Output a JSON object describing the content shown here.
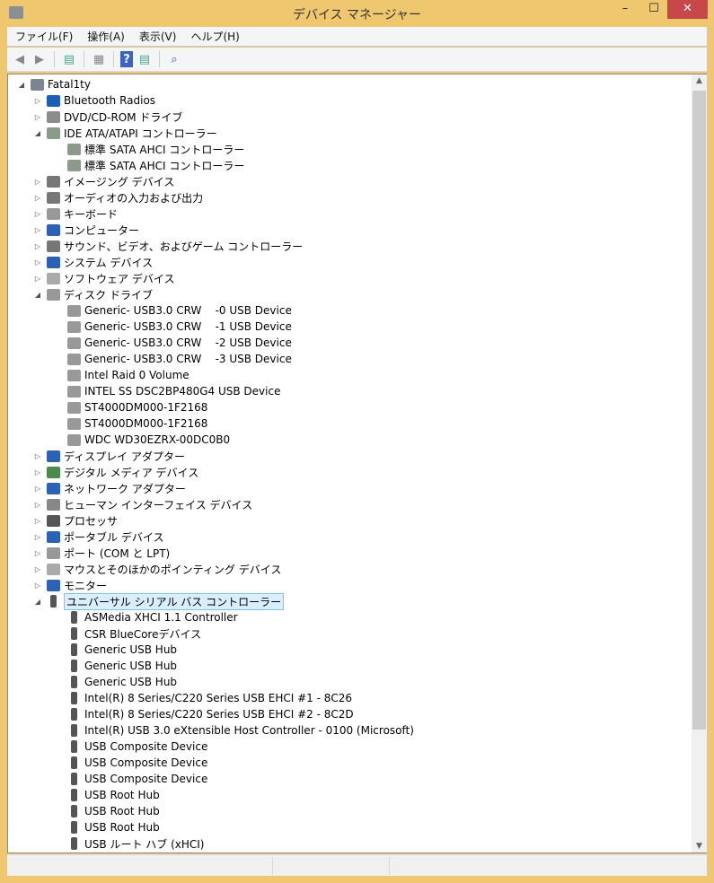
{
  "window": {
    "title": "デバイス マネージャー",
    "minimize": "–",
    "maximize": "☐",
    "close": "✕"
  },
  "menu": [
    "ファイル(F)",
    "操作(A)",
    "表示(V)",
    "ヘルプ(H)"
  ],
  "tree": [
    {
      "label": "Fatal1ty",
      "level": 0,
      "exp": "open",
      "icon": "computer-icon",
      "color": "#7c8591"
    },
    {
      "label": "Bluetooth Radios",
      "level": 1,
      "exp": "closed",
      "icon": "bluetooth-icon",
      "color": "#1d5fb8"
    },
    {
      "label": "DVD/CD-ROM ドライブ",
      "level": 1,
      "exp": "closed",
      "icon": "dvd-drive-icon",
      "color": "#8c8c8c"
    },
    {
      "label": "IDE ATA/ATAPI コントローラー",
      "level": 1,
      "exp": "open",
      "icon": "ide-controller-icon",
      "color": "#8c9a8c"
    },
    {
      "label": "標準 SATA AHCI コントローラー",
      "level": 2,
      "icon": "ide-controller-icon",
      "color": "#8c9a8c"
    },
    {
      "label": "標準 SATA AHCI コントローラー",
      "level": 2,
      "icon": "ide-controller-icon",
      "color": "#8c9a8c"
    },
    {
      "label": "イメージング デバイス",
      "level": 1,
      "exp": "closed",
      "icon": "scanner-icon",
      "color": "#777"
    },
    {
      "label": "オーディオの入力および出力",
      "level": 1,
      "exp": "closed",
      "icon": "speaker-icon",
      "color": "#777"
    },
    {
      "label": "キーボード",
      "level": 1,
      "exp": "closed",
      "icon": "keyboard-icon",
      "color": "#999"
    },
    {
      "label": "コンピューター",
      "level": 1,
      "exp": "closed",
      "icon": "monitor-icon",
      "color": "#2a62b8"
    },
    {
      "label": "サウンド、ビデオ、およびゲーム コントローラー",
      "level": 1,
      "exp": "closed",
      "icon": "speaker-icon",
      "color": "#777"
    },
    {
      "label": "システム デバイス",
      "level": 1,
      "exp": "closed",
      "icon": "monitor-icon",
      "color": "#2a62b8"
    },
    {
      "label": "ソフトウェア デバイス",
      "level": 1,
      "exp": "closed",
      "icon": "software-device-icon",
      "color": "#aaa"
    },
    {
      "label": "ディスク ドライブ",
      "level": 1,
      "exp": "open",
      "icon": "disk-drive-icon",
      "color": "#999"
    },
    {
      "label": "Generic- USB3.0 CRW    -0 USB Device",
      "level": 2,
      "icon": "disk-drive-icon",
      "color": "#999"
    },
    {
      "label": "Generic- USB3.0 CRW    -1 USB Device",
      "level": 2,
      "icon": "disk-drive-icon",
      "color": "#999"
    },
    {
      "label": "Generic- USB3.0 CRW    -2 USB Device",
      "level": 2,
      "icon": "disk-drive-icon",
      "color": "#999"
    },
    {
      "label": "Generic- USB3.0 CRW    -3 USB Device",
      "level": 2,
      "icon": "disk-drive-icon",
      "color": "#999"
    },
    {
      "label": "Intel Raid 0 Volume",
      "level": 2,
      "icon": "disk-drive-icon",
      "color": "#999"
    },
    {
      "label": "INTEL SS DSC2BP480G4 USB Device",
      "level": 2,
      "icon": "disk-drive-icon",
      "color": "#999"
    },
    {
      "label": "ST4000DM000-1F2168",
      "level": 2,
      "icon": "disk-drive-icon",
      "color": "#999"
    },
    {
      "label": "ST4000DM000-1F2168",
      "level": 2,
      "icon": "disk-drive-icon",
      "color": "#999"
    },
    {
      "label": "WDC WD30EZRX-00DC0B0",
      "level": 2,
      "icon": "disk-drive-icon",
      "color": "#999"
    },
    {
      "label": "ディスプレイ アダプター",
      "level": 1,
      "exp": "closed",
      "icon": "display-adapter-icon",
      "color": "#2a62b8"
    },
    {
      "label": "デジタル メディア デバイス",
      "level": 1,
      "exp": "closed",
      "icon": "media-device-icon",
      "color": "#4a8a4a"
    },
    {
      "label": "ネットワーク アダプター",
      "level": 1,
      "exp": "closed",
      "icon": "network-icon",
      "color": "#2a62b8"
    },
    {
      "label": "ヒューマン インターフェイス デバイス",
      "level": 1,
      "exp": "closed",
      "icon": "hid-icon",
      "color": "#888"
    },
    {
      "label": "プロセッサ",
      "level": 1,
      "exp": "closed",
      "icon": "processor-icon",
      "color": "#555"
    },
    {
      "label": "ポータブル デバイス",
      "level": 1,
      "exp": "closed",
      "icon": "portable-device-icon",
      "color": "#2a62b8"
    },
    {
      "label": "ポート (COM と LPT)",
      "level": 1,
      "exp": "closed",
      "icon": "port-icon",
      "color": "#999"
    },
    {
      "label": "マウスとそのほかのポインティング デバイス",
      "level": 1,
      "exp": "closed",
      "icon": "mouse-icon",
      "color": "#aaa"
    },
    {
      "label": "モニター",
      "level": 1,
      "exp": "closed",
      "icon": "monitor-icon",
      "color": "#2a62b8"
    },
    {
      "label": "ユニバーサル シリアル バス コントローラー",
      "level": 1,
      "exp": "open",
      "icon": "usb-icon",
      "color": "#555",
      "selected": true
    },
    {
      "label": "ASMedia XHCI 1.1 Controller",
      "level": 2,
      "icon": "usb-icon",
      "color": "#555"
    },
    {
      "label": "CSR BlueCoreデバイス",
      "level": 2,
      "icon": "usb-icon",
      "color": "#555"
    },
    {
      "label": "Generic USB Hub",
      "level": 2,
      "icon": "usb-icon",
      "color": "#555"
    },
    {
      "label": "Generic USB Hub",
      "level": 2,
      "icon": "usb-icon",
      "color": "#555"
    },
    {
      "label": "Generic USB Hub",
      "level": 2,
      "icon": "usb-icon",
      "color": "#555"
    },
    {
      "label": "Intel(R) 8 Series/C220 Series USB EHCI #1 - 8C26",
      "level": 2,
      "icon": "usb-icon",
      "color": "#555"
    },
    {
      "label": "Intel(R) 8 Series/C220 Series USB EHCI #2 - 8C2D",
      "level": 2,
      "icon": "usb-icon",
      "color": "#555"
    },
    {
      "label": "Intel(R) USB 3.0 eXtensible Host Controller - 0100 (Microsoft)",
      "level": 2,
      "icon": "usb-icon",
      "color": "#555"
    },
    {
      "label": "USB Composite Device",
      "level": 2,
      "icon": "usb-icon",
      "color": "#555"
    },
    {
      "label": "USB Composite Device",
      "level": 2,
      "icon": "usb-icon",
      "color": "#555"
    },
    {
      "label": "USB Composite Device",
      "level": 2,
      "icon": "usb-icon",
      "color": "#555"
    },
    {
      "label": "USB Root Hub",
      "level": 2,
      "icon": "usb-icon",
      "color": "#555"
    },
    {
      "label": "USB Root Hub",
      "level": 2,
      "icon": "usb-icon",
      "color": "#555"
    },
    {
      "label": "USB Root Hub",
      "level": 2,
      "icon": "usb-icon",
      "color": "#555"
    },
    {
      "label": "USB ルート ハブ (xHCI)",
      "level": 2,
      "icon": "usb-icon",
      "color": "#555"
    }
  ]
}
